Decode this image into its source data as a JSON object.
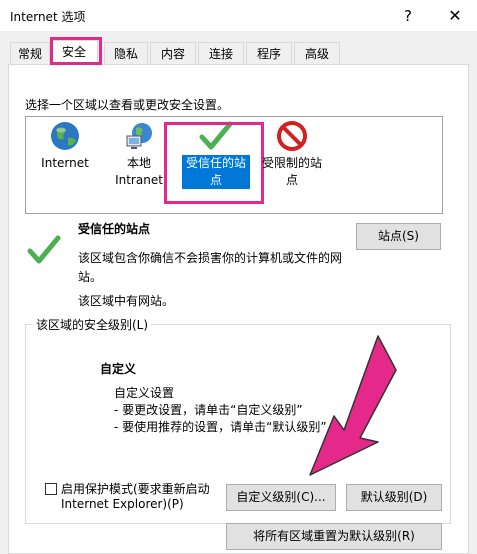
{
  "window": {
    "title": "Internet 选项",
    "help": "?",
    "close": "✕"
  },
  "tabs": [
    "常规",
    "安全",
    "隐私",
    "内容",
    "连接",
    "程序",
    "高级"
  ],
  "instruction": "选择一个区域以查看或更改安全设置。",
  "zones": [
    {
      "line1": "Internet",
      "line2": ""
    },
    {
      "line1": "本地",
      "line2": "Intranet"
    },
    {
      "line1": "受信任的站",
      "line2": "点"
    },
    {
      "line1": "受限制的站",
      "line2": "点"
    }
  ],
  "zone_info": {
    "name": "受信任的站点",
    "desc_line1": "该区域包含你确信不会损害你的计算机或文件的网",
    "desc_line2": "站。",
    "status": "该区域中有网站。",
    "sites_button": "站点(S)"
  },
  "security_level": {
    "group_title": "该区域的安全级别(L)",
    "level_name": "自定义",
    "desc_title": "自定义设置",
    "bullet1": "- 要更改设置，请单击“自定义级别”",
    "bullet2": "- 要使用推荐的设置，请单击“默认级别”"
  },
  "protected_mode": {
    "line1": "启用保护模式(要求重新启动",
    "line2": "Internet Explorer)(P)"
  },
  "buttons": {
    "custom_level": "自定义级别(C)...",
    "default_level": "默认级别(D)",
    "reset_all": "将所有区域重置为默认级别(R)"
  },
  "colors": {
    "highlight": "#e5298a",
    "selected_zone": "#0078d7",
    "check_green": "#4caf50"
  }
}
